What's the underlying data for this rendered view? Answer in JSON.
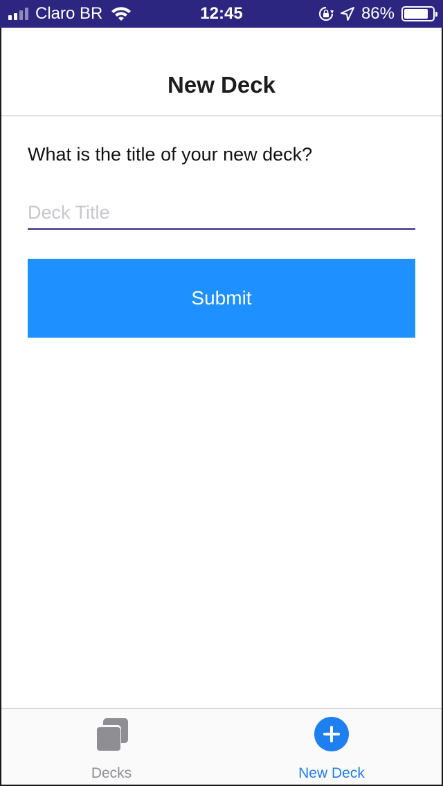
{
  "status_bar": {
    "carrier": "Claro BR",
    "time": "12:45",
    "battery_percent": "86%",
    "battery_level": 0.86,
    "signal_bars_filled": 2,
    "signal_bars_total": 4,
    "icons": [
      "signal-icon",
      "wifi-icon",
      "orientation-lock-icon",
      "location-icon",
      "battery-icon"
    ]
  },
  "header": {
    "title": "New Deck"
  },
  "form": {
    "question": "What is the title of your new deck?",
    "title_input": {
      "value": "",
      "placeholder": "Deck Title"
    },
    "submit_label": "Submit"
  },
  "tab_bar": {
    "tabs": [
      {
        "label": "Decks",
        "icon": "decks-icon",
        "active": false
      },
      {
        "label": "New Deck",
        "icon": "plus-circle-icon",
        "active": true
      }
    ]
  },
  "colors": {
    "status_bar_bg": "#2c2680",
    "accent": "#1e90ff",
    "tab_active": "#1e7ff0",
    "tab_inactive": "#8e8e93",
    "input_underline": "#2c2680",
    "placeholder": "#c7c7cc"
  }
}
